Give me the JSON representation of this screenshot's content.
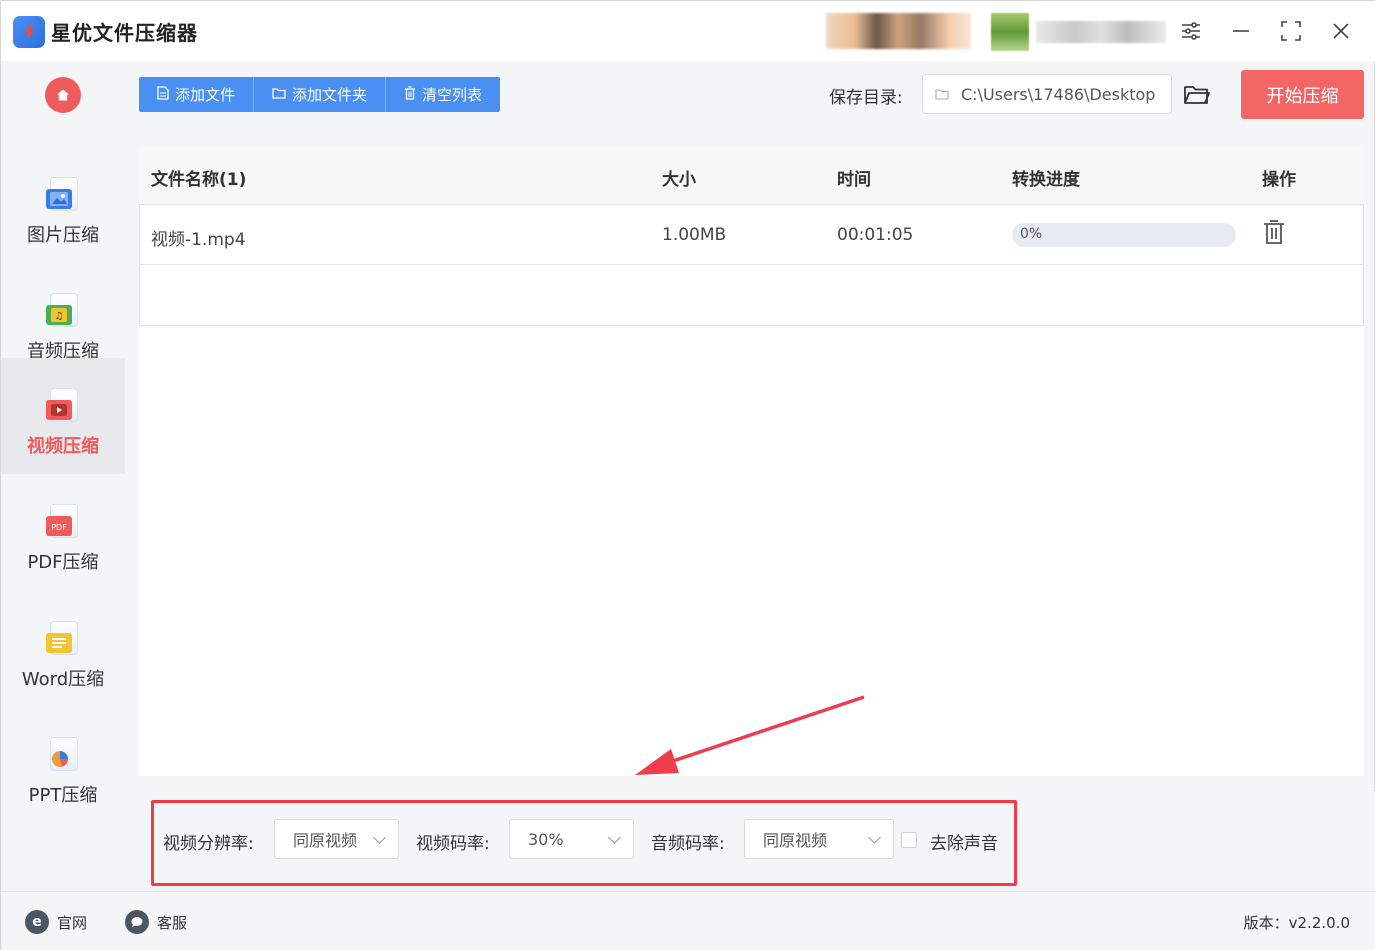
{
  "app": {
    "title": "星优文件压缩器"
  },
  "toolbar": {
    "add_file": "添加文件",
    "add_folder": "添加文件夹",
    "clear_list": "清空列表",
    "save_dir_label": "保存目录:",
    "save_dir_value": "C:\\Users\\17486\\Desktop",
    "start_label": "开始压缩"
  },
  "sidebar": {
    "items": [
      {
        "label": "图片压缩",
        "icon": "image-icon",
        "color": "#3c7be0"
      },
      {
        "label": "音频压缩",
        "icon": "music-icon",
        "color": "#4caf50"
      },
      {
        "label": "视频压缩",
        "icon": "video-icon",
        "color": "#f05b5b",
        "active": true
      },
      {
        "label": "PDF压缩",
        "icon": "pdf-icon",
        "color": "#f05b5b"
      },
      {
        "label": "Word压缩",
        "icon": "word-icon",
        "color": "#f4c430"
      },
      {
        "label": "PPT压缩",
        "icon": "ppt-icon",
        "color": "#f0993e"
      }
    ]
  },
  "table": {
    "headers": {
      "name": "文件名称(1)",
      "size": "大小",
      "time": "时间",
      "progress": "转换进度",
      "action": "操作"
    },
    "rows": [
      {
        "name": "视频-1.mp4",
        "size": "1.00MB",
        "time": "00:01:05",
        "progress_text": "0%",
        "progress": 0
      }
    ]
  },
  "settings": {
    "resolution_label": "视频分辨率:",
    "resolution_value": "同原视频",
    "video_bitrate_label": "视频码率:",
    "video_bitrate_value": "30%",
    "audio_bitrate_label": "音频码率:",
    "audio_bitrate_value": "同原视频",
    "remove_audio_label": "去除声音",
    "remove_audio_checked": false
  },
  "footer": {
    "website": "官网",
    "service": "客服",
    "version": "版本：v2.2.0.0"
  },
  "colors": {
    "accent_blue": "#4a90f2",
    "accent_red": "#f46565",
    "highlight_red": "#ef3d4a"
  }
}
